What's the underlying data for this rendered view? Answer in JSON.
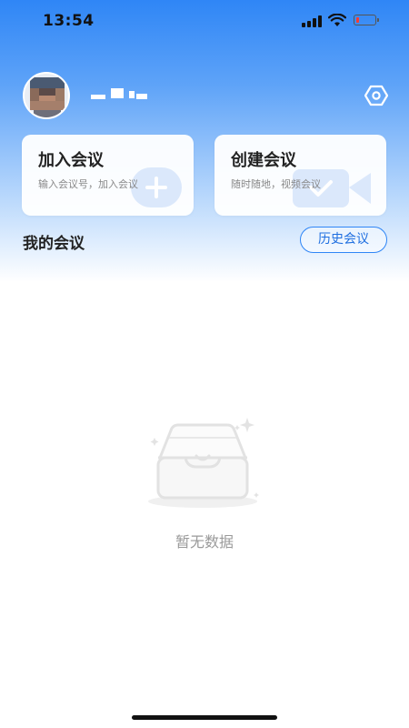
{
  "status_bar": {
    "time": "13:54",
    "battery_level": 0.15,
    "icons": [
      "cellular-signal-icon",
      "wifi-icon",
      "battery-low-icon"
    ]
  },
  "profile": {
    "avatar_icon": "avatar-pixelated",
    "settings_icon": "settings-hexagon-icon"
  },
  "actions": {
    "join": {
      "title": "加入会议",
      "subtitle": "输入会议号，加入会议",
      "icon": "plus-icon"
    },
    "create": {
      "title": "创建会议",
      "subtitle": "随时随地，视频会议",
      "icon": "video-camera-icon"
    }
  },
  "meetings": {
    "title": "我的会议",
    "history_button": "历史会议"
  },
  "empty_state": {
    "text": "暂无数据",
    "icon": "empty-inbox-icon"
  },
  "colors": {
    "accent": "#2f86f6",
    "header_gradient_top": "#2f86f6",
    "empty_text": "#9a9a9a"
  }
}
